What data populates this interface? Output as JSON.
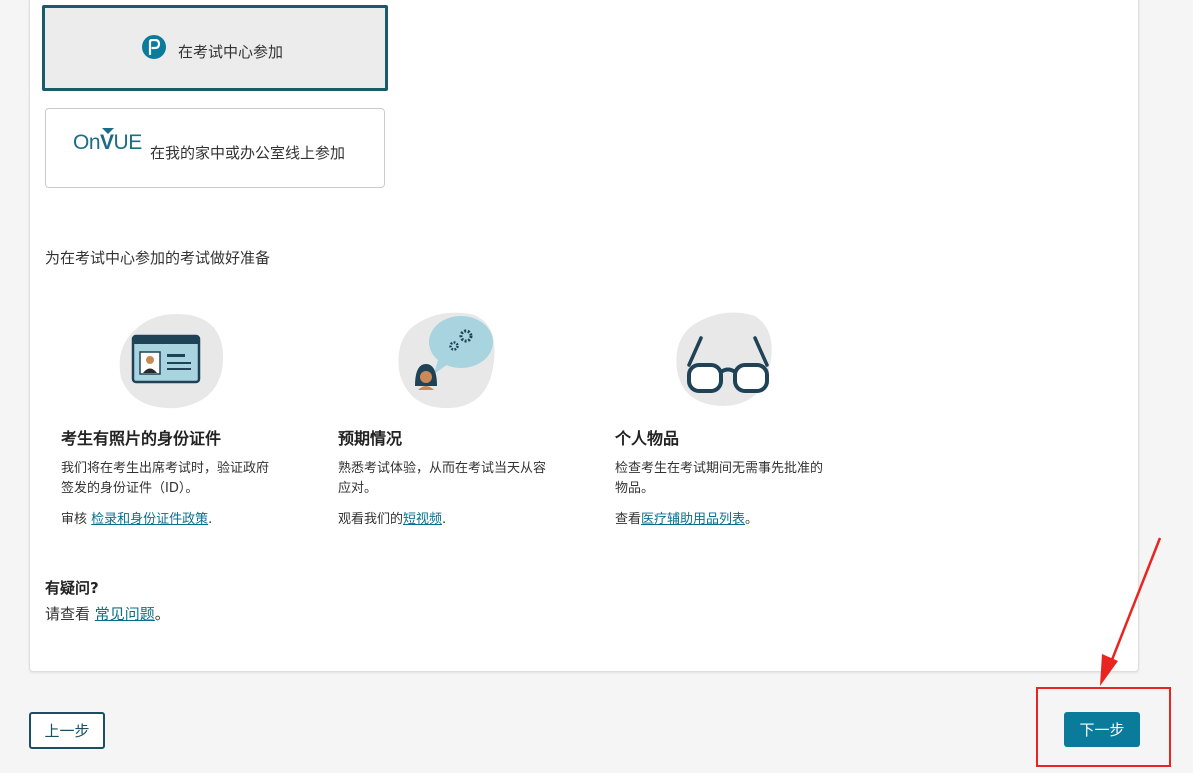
{
  "options": {
    "test_center": {
      "label": "在考试中心参加",
      "logo": "pearson-p-icon"
    },
    "online": {
      "brand_on": "On",
      "brand_v": "V",
      "brand_ue": "UE",
      "label": "在我的家中或办公室线上参加"
    }
  },
  "prep_heading": "为在考试中心参加的考试做好准备",
  "columns": [
    {
      "icon": "id-card-icon",
      "title": "考生有照片的身份证件",
      "desc": "我们将在考生出席考试时，验证政府签发的身份证件（ID）。",
      "link_prefix": "审核 ",
      "link_text": "检录和身份证件政策",
      "link_suffix": "."
    },
    {
      "icon": "person-thinking-icon",
      "title": "预期情况",
      "desc": "熟悉考试体验，从而在考试当天从容应对。",
      "link_prefix": "观看我们的",
      "link_text": "短视频",
      "link_suffix": "."
    },
    {
      "icon": "glasses-icon",
      "title": "个人物品",
      "desc": "检查考生在考试期间无需事先批准的物品。",
      "link_prefix": "查看",
      "link_text": "医疗辅助用品列表",
      "link_suffix": "。"
    }
  ],
  "faq": {
    "title": "有疑问?",
    "prefix": "请查看 ",
    "link_text": "常见问题",
    "suffix": "。"
  },
  "nav": {
    "prev_label": "上一步",
    "next_label": "下一步"
  },
  "colors": {
    "brand": "#0a7b9b",
    "annotation": "#e8251f"
  }
}
